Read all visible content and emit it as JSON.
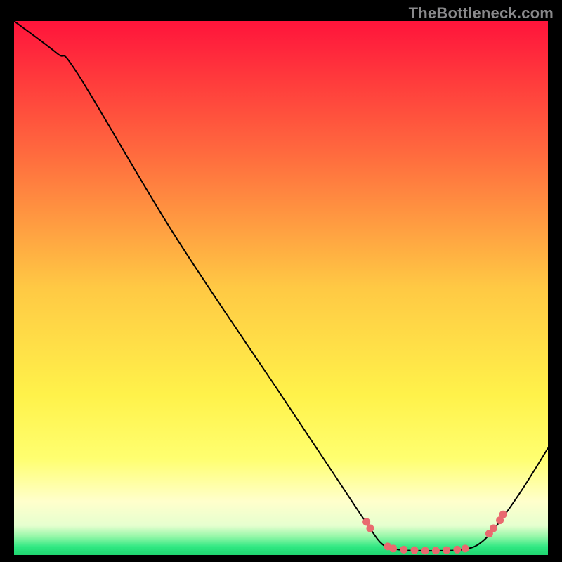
{
  "attribution": "TheBottleneck.com",
  "chart_data": {
    "type": "line",
    "title": "",
    "xlabel": "",
    "ylabel": "",
    "xlim": [
      0,
      100
    ],
    "ylim": [
      0,
      100
    ],
    "grid": false,
    "background_gradient": {
      "stops": [
        {
          "offset": 0.0,
          "color": "#ff143b"
        },
        {
          "offset": 0.25,
          "color": "#ff6b3e"
        },
        {
          "offset": 0.5,
          "color": "#ffc944"
        },
        {
          "offset": 0.7,
          "color": "#fff24a"
        },
        {
          "offset": 0.82,
          "color": "#ffff70"
        },
        {
          "offset": 0.9,
          "color": "#ffffcc"
        },
        {
          "offset": 0.945,
          "color": "#e6ffcf"
        },
        {
          "offset": 0.965,
          "color": "#97f7a9"
        },
        {
          "offset": 0.985,
          "color": "#2fe882"
        },
        {
          "offset": 1.0,
          "color": "#1fd56f"
        }
      ]
    },
    "series": [
      {
        "name": "bottleneck-curve",
        "stroke": "#000000",
        "stroke_width": 2,
        "points": [
          {
            "x": 0,
            "y": 100
          },
          {
            "x": 8,
            "y": 94
          },
          {
            "x": 12,
            "y": 90
          },
          {
            "x": 30,
            "y": 60
          },
          {
            "x": 50,
            "y": 30
          },
          {
            "x": 60,
            "y": 15
          },
          {
            "x": 66,
            "y": 6
          },
          {
            "x": 69,
            "y": 2
          },
          {
            "x": 72,
            "y": 1
          },
          {
            "x": 76,
            "y": 0.8
          },
          {
            "x": 80,
            "y": 0.8
          },
          {
            "x": 84,
            "y": 1
          },
          {
            "x": 87,
            "y": 2
          },
          {
            "x": 90,
            "y": 5
          },
          {
            "x": 95,
            "y": 12
          },
          {
            "x": 100,
            "y": 20
          }
        ]
      }
    ],
    "markers": {
      "color": "#e96a6f",
      "radius": 5.5,
      "points": [
        {
          "x": 66,
          "y": 6.2
        },
        {
          "x": 66.7,
          "y": 5.0
        },
        {
          "x": 70,
          "y": 1.6
        },
        {
          "x": 71,
          "y": 1.2
        },
        {
          "x": 73,
          "y": 1.0
        },
        {
          "x": 75,
          "y": 0.9
        },
        {
          "x": 77,
          "y": 0.8
        },
        {
          "x": 79,
          "y": 0.8
        },
        {
          "x": 81,
          "y": 0.9
        },
        {
          "x": 83,
          "y": 1.0
        },
        {
          "x": 84.5,
          "y": 1.2
        },
        {
          "x": 89,
          "y": 4.0
        },
        {
          "x": 89.8,
          "y": 5.0
        },
        {
          "x": 91,
          "y": 6.5
        },
        {
          "x": 91.6,
          "y": 7.6
        }
      ]
    }
  }
}
